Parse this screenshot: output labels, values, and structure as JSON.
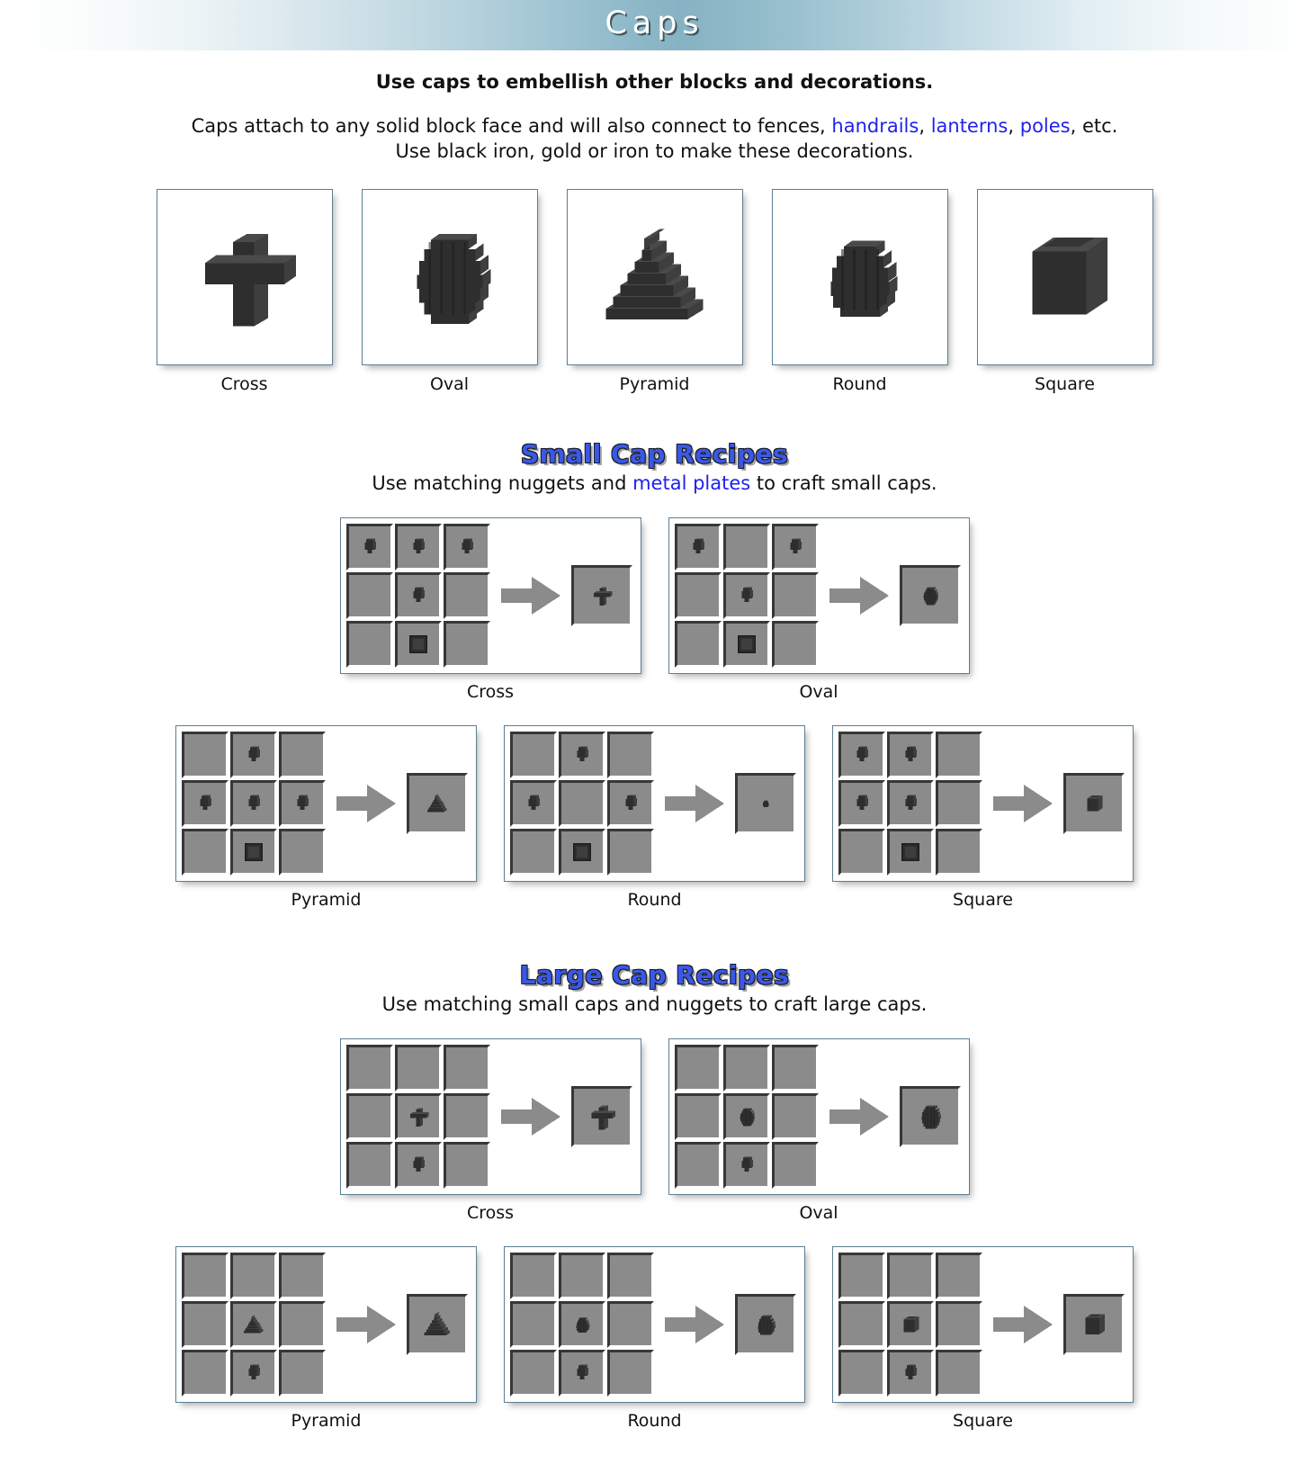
{
  "header": {
    "title": "Caps"
  },
  "intro": {
    "lead": "Use caps to embellish other blocks and decorations.",
    "body_1": "Caps attach to any solid block face and will also connect to fences, ",
    "link_handrails": "handrails",
    "sep_1": ", ",
    "link_lanterns": "lanterns",
    "sep_2": ", ",
    "link_poles": "poles",
    "body_2": ", etc.",
    "body_3": "Use black iron, gold or iron to make these decorations."
  },
  "gallery": {
    "items": [
      {
        "label": "Cross",
        "shape": "cross"
      },
      {
        "label": "Oval",
        "shape": "oval"
      },
      {
        "label": "Pyramid",
        "shape": "pyramid"
      },
      {
        "label": "Round",
        "shape": "round"
      },
      {
        "label": "Square",
        "shape": "square"
      }
    ]
  },
  "small_section": {
    "heading": "Small Cap Recipes",
    "sub_before": "Use matching nuggets and ",
    "sub_link": "metal plates",
    "sub_after": " to craft small caps.",
    "row1": [
      {
        "label": "Cross",
        "grid": [
          "nugget",
          "nugget",
          "nugget",
          "",
          "nugget",
          "",
          "",
          "plate",
          ""
        ],
        "result": "cross"
      },
      {
        "label": "Oval",
        "grid": [
          "nugget",
          "",
          "nugget",
          "",
          "nugget",
          "",
          "",
          "plate",
          ""
        ],
        "result": "oval"
      }
    ],
    "row2": [
      {
        "label": "Pyramid",
        "grid": [
          "",
          "nugget",
          "",
          "nugget",
          "nugget",
          "nugget",
          "",
          "plate",
          ""
        ],
        "result": "pyramid"
      },
      {
        "label": "Round",
        "grid": [
          "",
          "nugget",
          "",
          "nugget",
          "",
          "nugget",
          "",
          "plate",
          ""
        ],
        "result": "round"
      },
      {
        "label": "Square",
        "grid": [
          "nugget",
          "nugget",
          "",
          "nugget",
          "nugget",
          "",
          "",
          "plate",
          ""
        ],
        "result": "square"
      }
    ]
  },
  "large_section": {
    "heading": "Large Cap Recipes",
    "sub": "Use matching small caps and nuggets to craft large caps.",
    "row1": [
      {
        "label": "Cross",
        "grid": [
          "",
          "",
          "",
          "",
          "cap_cross",
          "",
          "",
          "nugget",
          ""
        ],
        "result": "cross"
      },
      {
        "label": "Oval",
        "grid": [
          "",
          "",
          "",
          "",
          "cap_oval",
          "",
          "",
          "nugget",
          ""
        ],
        "result": "oval"
      }
    ],
    "row2": [
      {
        "label": "Pyramid",
        "grid": [
          "",
          "",
          "",
          "",
          "cap_pyramid",
          "",
          "",
          "nugget",
          ""
        ],
        "result": "pyramid"
      },
      {
        "label": "Round",
        "grid": [
          "",
          "",
          "",
          "",
          "cap_round",
          "",
          "",
          "nugget",
          ""
        ],
        "result": "round"
      },
      {
        "label": "Square",
        "grid": [
          "",
          "",
          "",
          "",
          "cap_square",
          "",
          "",
          "nugget",
          ""
        ],
        "result": "square"
      }
    ]
  },
  "colors": {
    "accent_heading": "#3a58e8",
    "link": "#2121ee",
    "slot_bg": "#8b8b8b",
    "voxel_dark": "#2b2b2b",
    "header_gradient_center": "#86b2c3"
  },
  "icons": {
    "arrow": "arrow-right-icon"
  }
}
